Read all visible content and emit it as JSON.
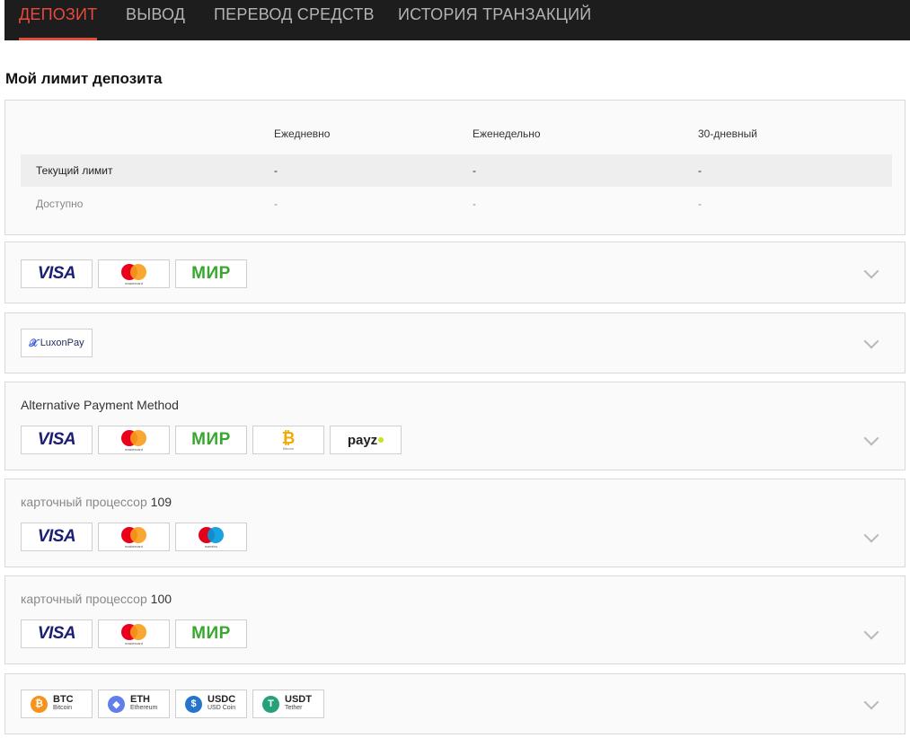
{
  "nav": {
    "tabs": [
      {
        "label": "ДЕПОЗИТ",
        "active": true
      },
      {
        "label": "ВЫВОД",
        "active": false
      },
      {
        "label": "ПЕРЕВОД СРЕДСТВ",
        "active": false
      },
      {
        "label": "ИСТОРИЯ ТРАНЗАКЦИЙ",
        "active": false
      }
    ],
    "accent_color": "#e84a3c"
  },
  "limits": {
    "title": "Мой лимит депозита",
    "columns": [
      "Ежедневно",
      "Еженедельно",
      "30-дневный"
    ],
    "rows": [
      {
        "label": "Текущий лимит",
        "values": [
          "-",
          "-",
          "-"
        ]
      },
      {
        "label": "Доступно",
        "values": [
          "-",
          "-",
          "-"
        ]
      }
    ]
  },
  "methods": [
    {
      "title": "",
      "badges": [
        "visa",
        "mastercard",
        "mir"
      ]
    },
    {
      "title": "",
      "badges": [
        "luxonpay"
      ]
    },
    {
      "title": "Alternative Payment Method",
      "badges": [
        "visa",
        "mastercard",
        "mir",
        "bitcoin",
        "payz"
      ]
    },
    {
      "title_prefix": "карточный процессор",
      "title_number": "109",
      "badges": [
        "visa",
        "mastercard",
        "maestro"
      ]
    },
    {
      "title_prefix": "карточный процессор",
      "title_number": "100",
      "badges": [
        "visa",
        "mastercard",
        "mir"
      ]
    },
    {
      "title": "",
      "badges": [
        "btc",
        "eth",
        "usdc",
        "usdt"
      ]
    }
  ],
  "badge_text": {
    "visa": "VISA",
    "mir": "МИР",
    "luxon_mark": "𝒳",
    "luxon_name": "LuxonPay",
    "payz": "payz",
    "bitcoin_caption": "Bitcoin",
    "btc": {
      "symbol": "BTC",
      "name": "Bitcoin",
      "glyph": "₿"
    },
    "eth": {
      "symbol": "ETH",
      "name": "Ethereum",
      "glyph": "◆"
    },
    "usdc": {
      "symbol": "USDC",
      "name": "USD Coin",
      "glyph": "$"
    },
    "usdt": {
      "symbol": "USDT",
      "name": "Tether",
      "glyph": "T"
    }
  }
}
